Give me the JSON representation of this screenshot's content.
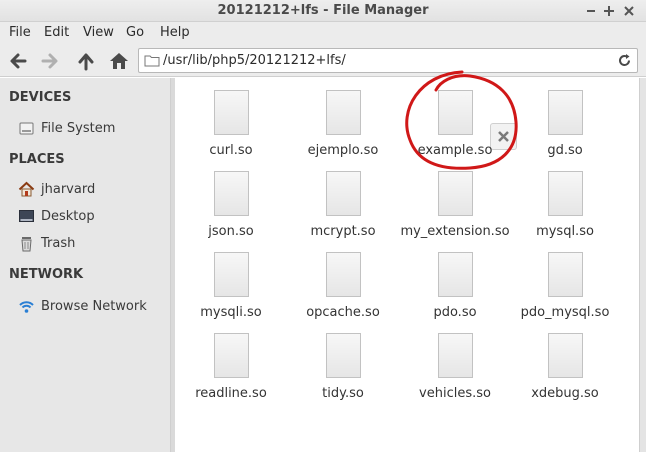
{
  "window": {
    "title": "20121212+lfs - File Manager",
    "controls": [
      "minimize",
      "maximize",
      "close"
    ]
  },
  "menubar": {
    "items": [
      "File",
      "Edit",
      "View",
      "Go",
      "Help"
    ]
  },
  "toolbar": {
    "buttons": [
      "back-icon",
      "forward-icon",
      "up-icon",
      "home-icon"
    ],
    "path": "/usr/lib/php5/20121212+lfs/"
  },
  "sidebar": {
    "sections": [
      {
        "heading": "DEVICES",
        "items": [
          {
            "label": "File System",
            "icon": "drive-icon"
          }
        ]
      },
      {
        "heading": "PLACES",
        "items": [
          {
            "label": "jharvard",
            "icon": "home-icon"
          },
          {
            "label": "Desktop",
            "icon": "desktop-icon"
          },
          {
            "label": "Trash",
            "icon": "trash-icon"
          }
        ]
      },
      {
        "heading": "NETWORK",
        "items": [
          {
            "label": "Browse Network",
            "icon": "network-icon"
          }
        ]
      }
    ]
  },
  "files": [
    "curl.so",
    "ejemplo.so",
    "example.so",
    "gd.so",
    "json.so",
    "mcrypt.so",
    "my_extension.so",
    "mysql.so",
    "mysqli.so",
    "opcache.so",
    "pdo.so",
    "pdo_mysql.so",
    "readline.so",
    "tidy.so",
    "vehicles.so",
    "xdebug.so"
  ],
  "annotation": {
    "highlighted_file": "example.so",
    "circle_color": "#d01818"
  },
  "colors": {
    "sidebar_bg": "#e7e7e7",
    "chrome_bg": "#ececec",
    "icon_dark": "#4a4a4a"
  }
}
